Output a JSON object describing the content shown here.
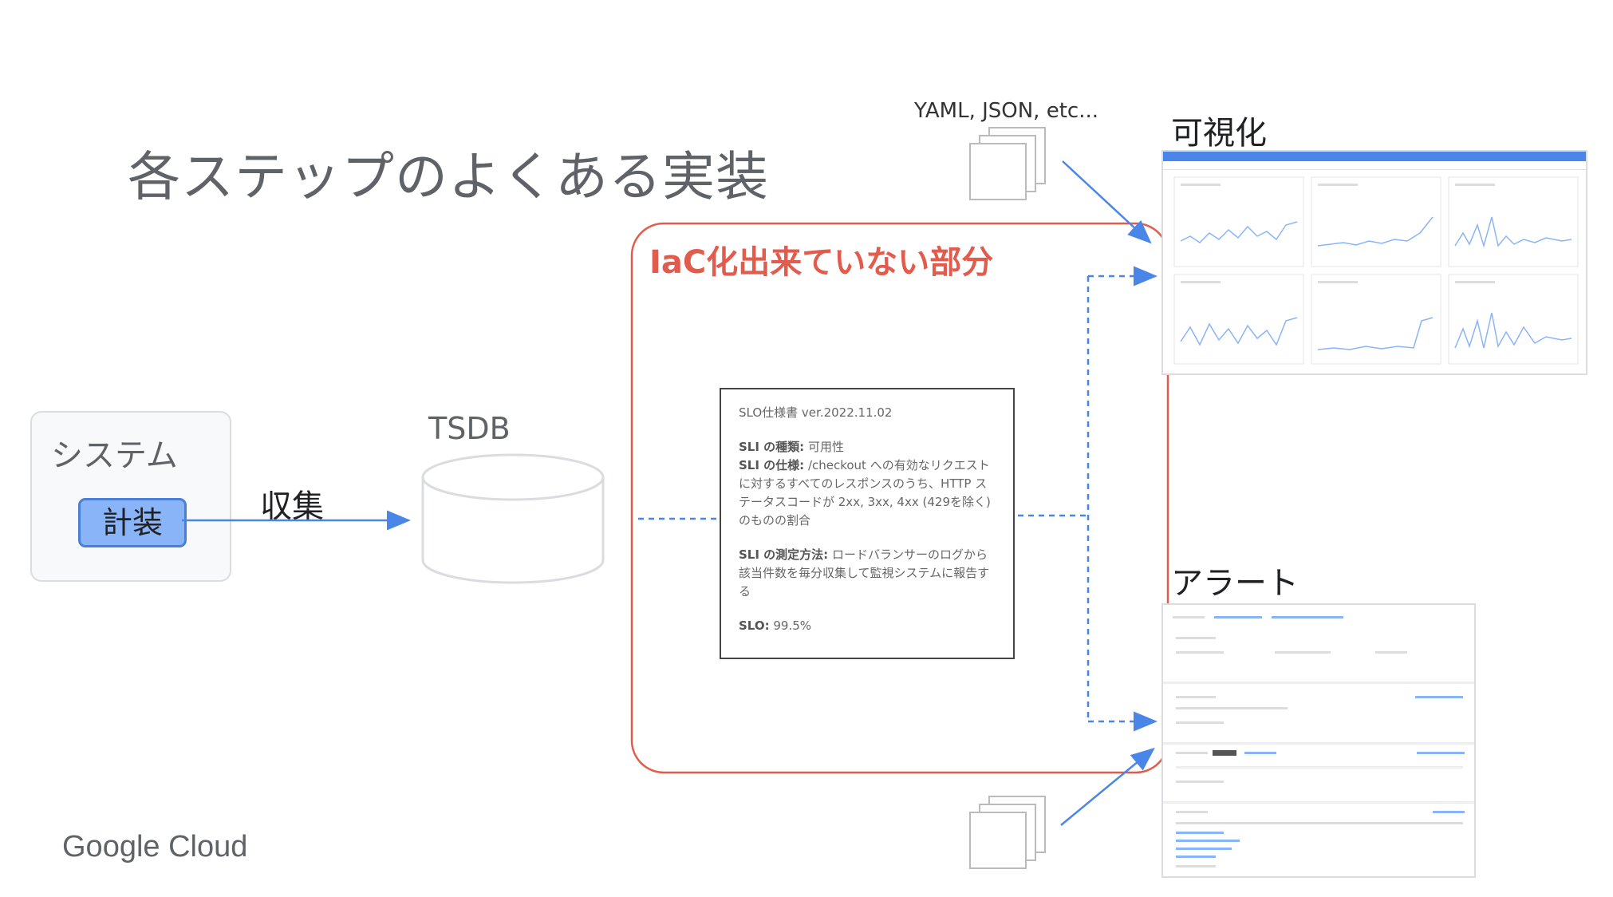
{
  "title": "各ステップのよくある実装",
  "system": {
    "label": "システム",
    "instrument": "計装"
  },
  "collect": "収集",
  "tsdb": "TSDB",
  "iac_box": {
    "label": "IaC化出来ていない部分",
    "color": "#e25c4d"
  },
  "slo_doc": {
    "header": "SLO仕様書 ver.2022.11.02",
    "sli_type_key": "SLI の種類:",
    "sli_type_val": " 可用性",
    "sli_spec_key": "SLI の仕様:",
    "sli_spec_val": " /checkout への有効なリクエストに対するすべてのレスポンスのうち、HTTP ステータスコードが 2xx, 3xx, 4xx (429を除く) のものの割合",
    "sli_method_key": "SLI の測定方法:",
    "sli_method_val": " ロードバランサーのログから該当件数を毎分収集して監視システムに報告する",
    "slo_key": "SLO:",
    "slo_val": " 99.5%"
  },
  "config_label": "YAML, JSON, etc...",
  "visualization_label": "可視化",
  "alert_label": "アラート",
  "logo": "Google Cloud",
  "colors": {
    "arrow": "#4a86e8",
    "box_border": "#e25c4d",
    "instrument_fill": "#8ab4f8"
  },
  "icons": [
    "document-stack-icon",
    "database-cylinder-icon",
    "arrow-icon"
  ]
}
